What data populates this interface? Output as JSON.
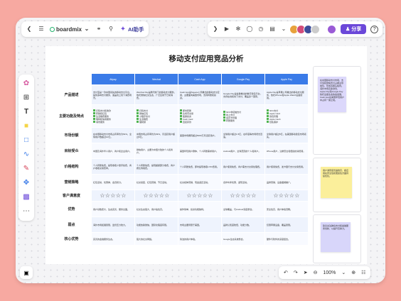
{
  "toolbar_left": {
    "back_icon": "chevron-left-icon",
    "menu_icon": "hamburger-menu-icon",
    "brand": "boardmix",
    "ai_label": "AI助手"
  },
  "toolbar_right": {
    "share_label": "分享",
    "help_label": "?"
  },
  "board": {
    "title": "移动支付应用竞品分析",
    "columns": [
      "Alipay",
      "Wechat",
      "Cash App",
      "Google Pay",
      "Apple Pay"
    ],
    "rows": [
      {
        "label": "产品描述",
        "cells": [
          "支付宝是一款中国领先的移动支付平台，提供多种支付服务，涵盖线上线下消费场景。",
          "WeChat Pay是腾讯旗下的移动支付服务，依托微信社交生态，广泛应用于日常消费。",
          "Cash App是Square公司推出的移动支付应用，主要面向美国市场，支持转账和投资。",
          "Google Pay是谷歌推出的数字钱包平台，支持在线和线下支付，覆盖多个国家。",
          "Apple Pay是苹果公司推出的移动支付服务，依托iPhone和Apple Watch设备使用。"
        ]
      },
      {
        "label": "主要功能及特点",
        "cells": [
          [
            "扫码支付和收款",
            "转账和红包",
            "生活缴费服务",
            "理财和信用服务",
            "城市服务"
          ],
          [
            "扫码支付",
            "微信红包",
            "小程序支付",
            "生活缴费",
            "理财通"
          ],
          [
            "即时转账",
            "比特币交易",
            "股票投资",
            "Cash Card",
            "直接存款"
          ],
          [
            "NFC非接触支付",
            "线上支付",
            "会员卡管理",
            "转账服务"
          ],
          [
            "NFC支付",
            "Apple Card",
            "钱包管理",
            "Apple Cash",
            "隐私保护"
          ]
        ]
      },
      {
        "label": "市场份额",
        "cells": [
          "在中国移动支付市场占有率约为54%，全球用户数超过10亿。",
          "中国市场占有率约为39%，月活跃用户超过9亿。",
          "美国市场拥有超过5000万月活跃用户。",
          "全球用户超过1.5亿，在印度等市场增长迅速。",
          "全球用户超过5亿，在美国移动钱包市场领先。"
        ]
      },
      {
        "label": "目标受众",
        "cells": [
          "中国及海外华人用户，商户和企业用户。",
          "微信用户，主要为中国大陆的个人和商户。",
          "美国年轻用户群体，个人转账需求用户。",
          "Android用户，全球范围的个人和商户。",
          "iPhone用户，注重安全和便捷的消费者。"
        ]
      },
      {
        "label": "价格结构",
        "cells": [
          "个人转账免费，提现收取少量手续费，商户收取交易费率。",
          "个人转账免费，提现超额部分收费，商户按比例收费。",
          "个人转账免费，即时提现收取1.5%费用。",
          "用户使用免费，商户需支付交易处理费。",
          "用户使用免费，发卡银行支付交易费用。"
        ]
      },
      {
        "label": "营销策略",
        "cells": [
          "红包活动、优惠券、会员积分。",
          "社交裂变、红包营销、节日活动。",
          "社交媒体营销、现金返还活动。",
          "合作伙伴优惠、返现活动。",
          "品牌营销、设备捆绑推广。"
        ]
      },
      {
        "label": "客户满意度",
        "stars": [
          5,
          5,
          5,
          5,
          5
        ]
      },
      {
        "label": "优势",
        "cells": [
          "用户基数庞大，生态完善，服务全面。",
          "社交生态强大，用户粘性高。",
          "操作简单，投资功能独特。",
          "全球覆盖，与Android深度整合。",
          "安全性高，用户体验流畅。"
        ]
      },
      {
        "label": "弱点",
        "cells": [
          "海外市场拓展受限，监管压力较大。",
          "功能依赖微信，国际化程度有限。",
          "市场主要局限于美国。",
          "品牌认知度较低，功能分散。",
          "仅限苹果设备，覆盖受限。"
        ]
      },
      {
        "label": "核心优势",
        "cells": [
          "完善的金融服务生态。",
          "强大的社交网络。",
          "简洁的用户体验。",
          "Google生态系统整合。",
          "硬件与软件的深度结合。"
        ]
      }
    ]
  },
  "notes": [
    {
      "text": "在中国移动支付市场，支付宝和微信支付占据主导地位，形成双寡头格局。",
      "sub": "海外市场竞争激烈，Apple Pay和Google Pay依托设备生态快速发展，Cash App在美国年轻用户中占有一席之地。",
      "color": "#dcd8fb"
    },
    {
      "text": "用户满意度普遍较高，各应用在安全性和便捷性方面持续优化。",
      "color": "#fbef9b"
    },
    {
      "text": "建议关注跨境支付和金融服务创新，以提升竞争力。",
      "color": "#d8d6fa"
    }
  ],
  "zoom": {
    "value": "100%"
  },
  "colors": {
    "accent": "#6b48d9",
    "header_blue": "#3a7be8",
    "background": "#f7a9a1"
  }
}
